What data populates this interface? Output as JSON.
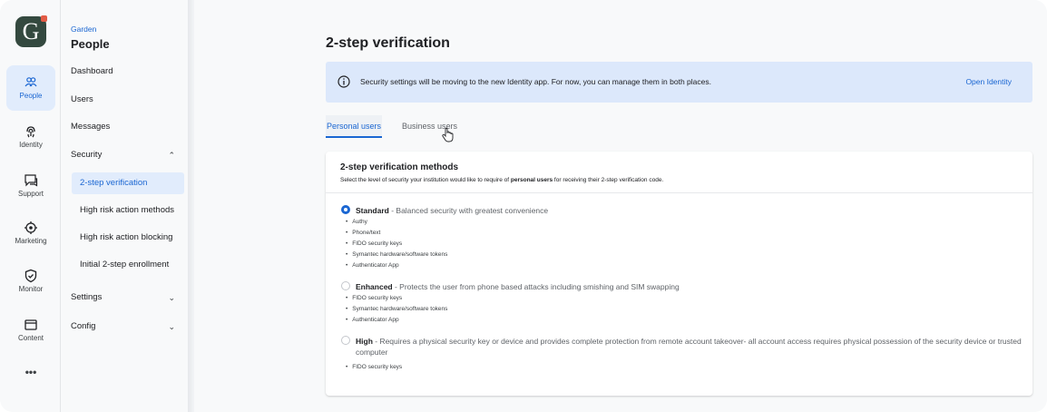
{
  "app": {
    "logo_letter": "G"
  },
  "rail": [
    {
      "label": "People",
      "icon": "people-icon",
      "active": true
    },
    {
      "label": "Identity",
      "icon": "fingerprint-icon",
      "active": false
    },
    {
      "label": "Support",
      "icon": "chat-icon",
      "active": false
    },
    {
      "label": "Marketing",
      "icon": "target-icon",
      "active": false
    },
    {
      "label": "Monitor",
      "icon": "shield-icon",
      "active": false
    },
    {
      "label": "Content",
      "icon": "content-icon",
      "active": false
    },
    {
      "label": "•••",
      "icon": "more-icon",
      "active": false
    }
  ],
  "nav": {
    "breadcrumb": "Garden",
    "title": "People",
    "items": {
      "dashboard": "Dashboard",
      "users": "Users",
      "messages": "Messages",
      "security": "Security",
      "settings": "Settings",
      "config": "Config"
    },
    "security_sub": {
      "two_step": "2-step verification",
      "high_risk_methods": "High risk action methods",
      "high_risk_blocking": "High risk action blocking",
      "initial_enrollment": "Initial 2-step enrollment"
    }
  },
  "main": {
    "title": "2-step verification",
    "banner": {
      "text": "Security settings will be moving to the new Identity app. For now, you can manage them in both places.",
      "link": "Open Identity"
    },
    "tabs": {
      "personal": "Personal users",
      "business": "Business users"
    },
    "card": {
      "title": "2-step verification methods",
      "desc_prefix": "Select the level of security your institution would like to require of ",
      "desc_bold": "personal users",
      "desc_suffix": " for receiving their 2-step verification code.",
      "options": {
        "standard": {
          "name": "Standard",
          "desc": " - Balanced security with greatest convenience",
          "selected": true,
          "bullets": [
            "Authy",
            "Phone/text",
            "FIDO security keys",
            "Symantec hardware/software tokens",
            "Authenticator App"
          ]
        },
        "enhanced": {
          "name": "Enhanced",
          "desc": " - Protects the user from phone based attacks including smishing and SIM swapping",
          "selected": false,
          "bullets": [
            "FIDO security keys",
            "Symantec hardware/software tokens",
            "Authenticator App"
          ]
        },
        "high": {
          "name": "High",
          "desc": " - Requires a physical security key or device and provides complete protection from remote account takeover- all account access requires physical possession of the security device or trusted computer",
          "selected": false,
          "bullets": [
            "FIDO security keys"
          ]
        }
      }
    }
  },
  "colors": {
    "accent": "#1a66d2",
    "banner_bg": "#dce8fb",
    "logo_bg": "#34493f"
  }
}
